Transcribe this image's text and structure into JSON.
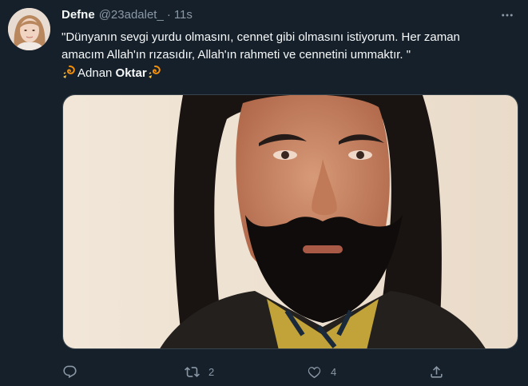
{
  "tweet": {
    "display_name": "Defne",
    "handle": "@23adalet_",
    "separator": "·",
    "time": "11s",
    "text_line1": "\"Dünyanın sevgi yurdu olmasını, cennet gibi olmasını istiyorum. Her zaman",
    "text_line2": "amacım Allah'ın rızasıdır, Allah'ın rahmeti ve cennetini ummaktır. \"",
    "signature_plain": "Adnan ",
    "signature_bold": "Oktar",
    "signature_emoji": "dizzy-emoji"
  },
  "actions": {
    "reply_count": "",
    "retweet_count": "2",
    "like_count": "4",
    "share_count": ""
  },
  "colors": {
    "background": "#15202b",
    "primary_text": "#f7f9f9",
    "secondary_text": "#8b98a5",
    "border": "#38444d"
  },
  "icons": [
    "more-icon",
    "reply-icon",
    "retweet-icon",
    "like-icon",
    "share-icon"
  ]
}
